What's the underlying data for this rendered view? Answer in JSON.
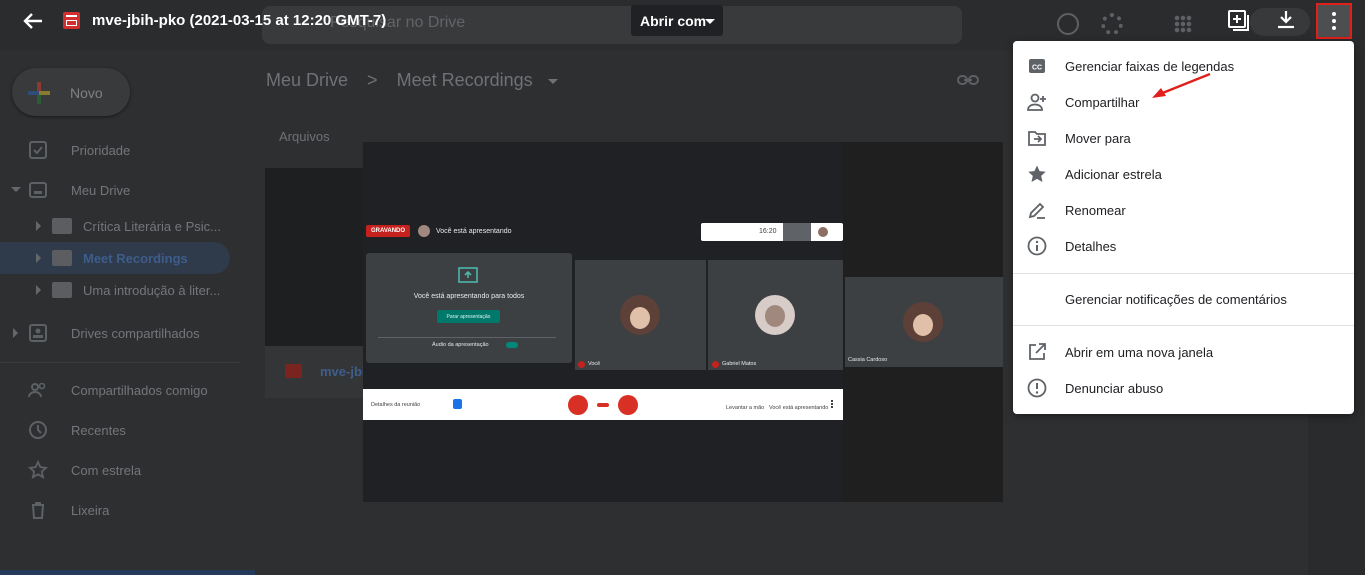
{
  "file": {
    "title": "mve-jbih-pko (2021-03-15 at 12:20 GMT-7)",
    "open_with_label": "Abrir com"
  },
  "drive": {
    "search_placeholder": "Pesquisar no Drive",
    "new_label": "Novo",
    "nav": [
      {
        "label": "Prioridade",
        "icon": "check-icon"
      },
      {
        "label": "Meu Drive",
        "icon": "drive-icon"
      }
    ],
    "folders": [
      {
        "label": "Crítica Literária e Psic..."
      },
      {
        "label": "Meet Recordings",
        "selected": true
      },
      {
        "label": "Uma introdução à liter..."
      }
    ],
    "nav2": [
      {
        "label": "Drives compartilhados"
      },
      {
        "label": "Compartilhados comigo"
      },
      {
        "label": "Recentes"
      },
      {
        "label": "Com estrela"
      },
      {
        "label": "Lixeira"
      }
    ],
    "breadcrumb": {
      "root": "Meu Drive",
      "separator": ">",
      "current": "Meet Recordings"
    },
    "section_label": "Arquivos",
    "file_card_name": "mve-jbi"
  },
  "video": {
    "recording_badge": "GRAVANDO",
    "presenting_status": "Você está apresentando",
    "clock": "16:20",
    "present_message": "Você está apresentando para todos",
    "stop_button": "Parar apresentação",
    "audio_label": "Áudio da apresentação",
    "participants": [
      {
        "name": "Você"
      },
      {
        "name": "Gabriel Matos"
      },
      {
        "name": "Cassia Cardoso"
      }
    ],
    "meeting_details": "Detalhes da reunião",
    "raise_hand": "Levantar a mão",
    "presenting_btn": "Você está apresentando"
  },
  "menu": {
    "items": [
      {
        "label": "Gerenciar faixas de legendas",
        "icon": "closed-captions-icon"
      },
      {
        "label": "Compartilhar",
        "icon": "add-person-icon"
      },
      {
        "label": "Mover para",
        "icon": "move-to-folder-icon"
      },
      {
        "label": "Adicionar estrela",
        "icon": "star-icon"
      },
      {
        "label": "Renomear",
        "icon": "pencil-icon"
      },
      {
        "label": "Detalhes",
        "icon": "info-icon"
      }
    ],
    "notifications_item": "Gerenciar notificações de comentários",
    "bottom_items": [
      {
        "label": "Abrir em uma nova janela",
        "icon": "open-new-window-icon"
      },
      {
        "label": "Denunciar abuso",
        "icon": "report-icon"
      }
    ]
  },
  "colors": {
    "accent": "#d32f2f",
    "highlight_border": "#e0201b",
    "annotation_arrow": "#e0201b"
  }
}
